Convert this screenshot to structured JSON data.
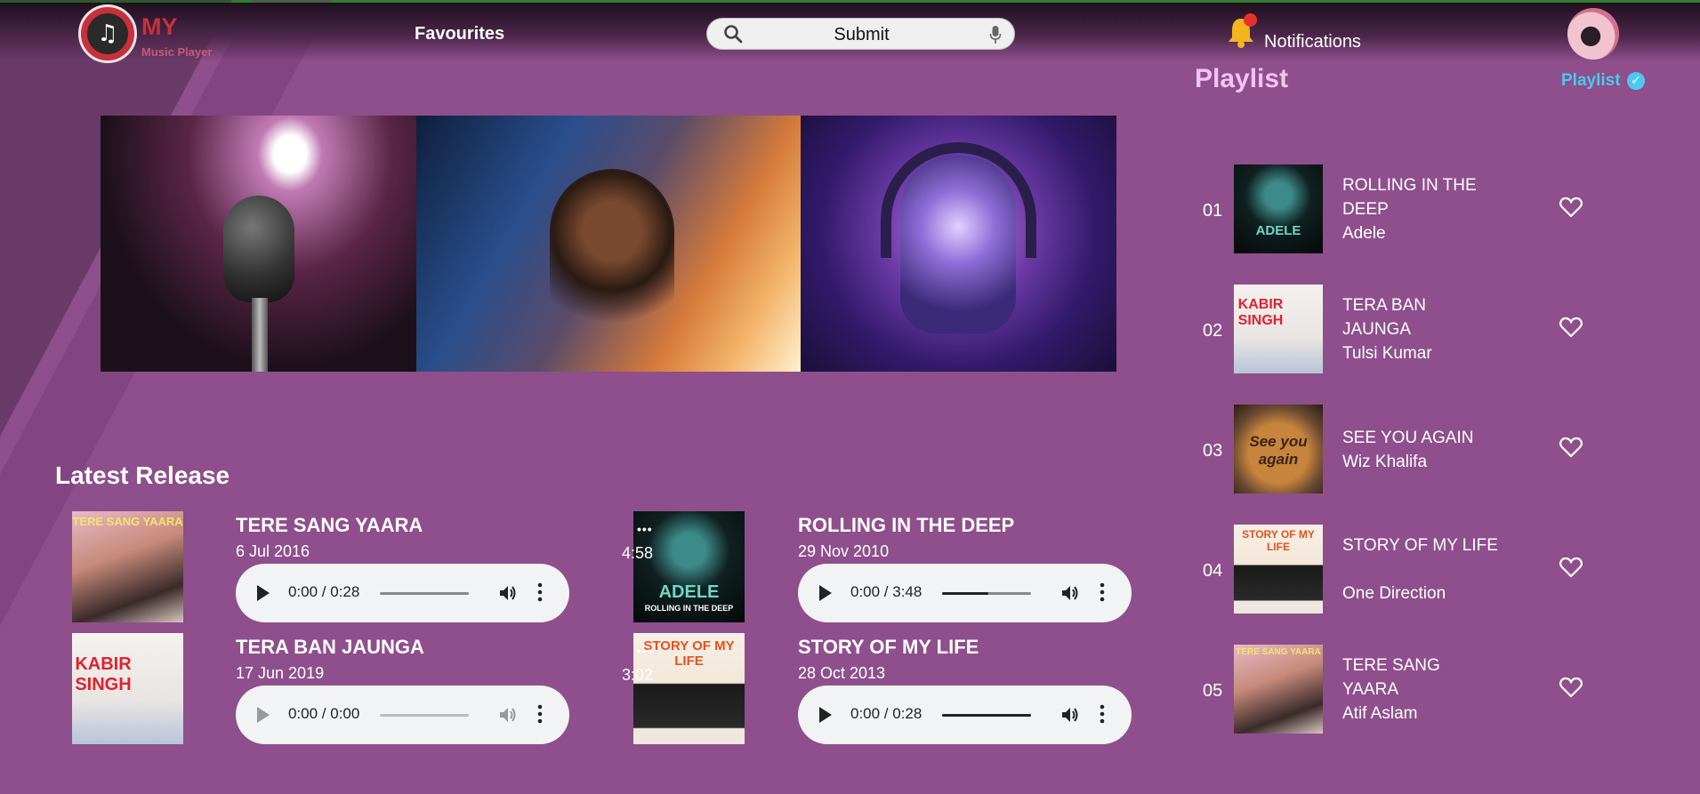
{
  "header": {
    "logo_title": "MY",
    "logo_subtitle": "Music Player",
    "nav_favourites": "Favourites",
    "search_text": "Submit",
    "notifications": "Notifications"
  },
  "banner": {
    "images": [
      "microphone-concert",
      "female-singer",
      "neon-skull-headphones"
    ]
  },
  "latest": {
    "title": "Latest Release",
    "items": [
      {
        "title": "TERE SANG YAARA",
        "date": "6 Jul 2016",
        "time": "0:00 / 0:28",
        "progress": 0.0,
        "cover": "TERE SANG YAARA"
      },
      {
        "title": "ROLLING IN THE DEEP",
        "date": "29 Nov 2010",
        "time": "0:00 / 3:48",
        "progress": 0.52,
        "cover": "ADELE",
        "cover_sub": "ROLLING IN THE DEEP",
        "overlay_dots": "•••",
        "overlay_duration": "4:58"
      },
      {
        "title": "TERA BAN JAUNGA",
        "date": "17 Jun 2019",
        "time": "0:00 / 0:00",
        "progress": 0.0,
        "cover": "KABIR SINGH"
      },
      {
        "title": "STORY OF MY LIFE",
        "date": "28 Oct 2013",
        "time": "0:00 / 0:28",
        "progress": 1.0,
        "cover": "STORY OF MY LIFE",
        "overlay_dots": "•••",
        "overlay_duration": "3:02"
      }
    ]
  },
  "playlist": {
    "title": "Playlist",
    "link": "Playlist",
    "items": [
      {
        "num": "01",
        "title": "ROLLING IN THE DEEP",
        "artist": "Adele",
        "cover": "ADELE"
      },
      {
        "num": "02",
        "title": "TERA BAN JAUNGA",
        "artist": "Tulsi Kumar",
        "cover": "KABIR SINGH"
      },
      {
        "num": "03",
        "title": "SEE YOU AGAIN",
        "artist": "Wiz Khalifa",
        "cover": "See you again"
      },
      {
        "num": "04",
        "title": "STORY OF MY LIFE",
        "artist": "One Direction",
        "cover": "STORY OF MY LIFE"
      },
      {
        "num": "05",
        "title": "TERE SANG YAARA",
        "artist": "Atif Aslam",
        "cover": "TERE SANG YAARA"
      }
    ]
  },
  "colors": {
    "background": "#8e4f8c",
    "brand_red": "#c9303c",
    "playlist_title": "#f3c4ef",
    "playlist_link": "#4cc9f0",
    "player_bg": "#f1f3f4"
  }
}
